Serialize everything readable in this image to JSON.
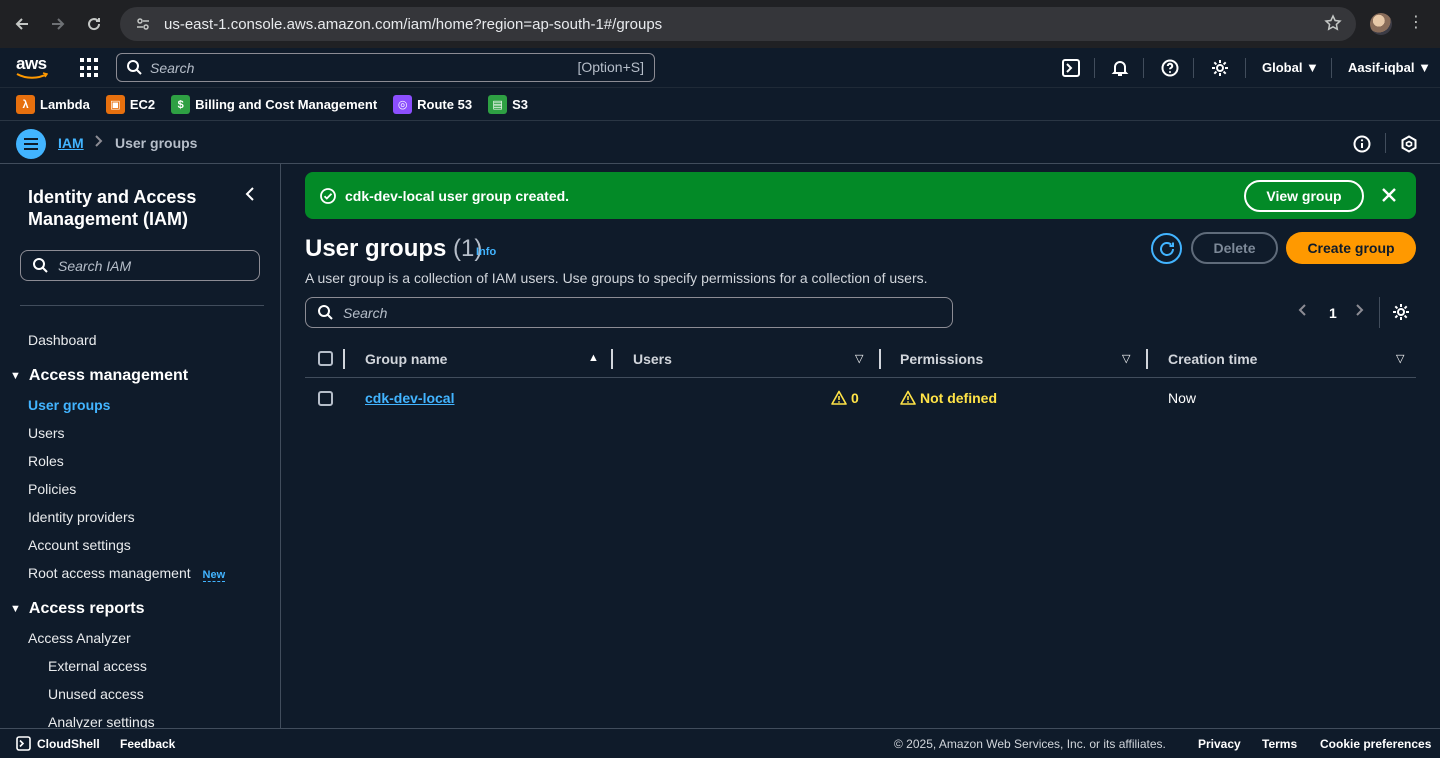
{
  "browser": {
    "url": "us-east-1.console.aws.amazon.com/iam/home?region=ap-south-1#/groups"
  },
  "aws_nav": {
    "logo_text": "aws",
    "search_placeholder": "Search",
    "search_shortcut": "[Option+S]",
    "region": "Global ▼",
    "user": "Aasif-iqbal ▼"
  },
  "favorites": [
    {
      "label": "Lambda",
      "color": "#e7700e",
      "glyph": "λ"
    },
    {
      "label": "EC2",
      "color": "#e7700e",
      "glyph": "▣"
    },
    {
      "label": "Billing and Cost Management",
      "color": "#2ea043",
      "glyph": "$"
    },
    {
      "label": "Route 53",
      "color": "#8c4fff",
      "glyph": "◎"
    },
    {
      "label": "S3",
      "color": "#2ea043",
      "glyph": "▤"
    }
  ],
  "breadcrumb": {
    "root": "IAM",
    "current": "User groups"
  },
  "sidebar": {
    "title": "Identity and Access Management (IAM)",
    "search_placeholder": "Search IAM",
    "dashboard": "Dashboard",
    "access_management": "Access management",
    "items": {
      "user_groups": "User groups",
      "users": "Users",
      "roles": "Roles",
      "policies": "Policies",
      "identity_providers": "Identity providers",
      "account_settings": "Account settings",
      "root_access": "Root access management",
      "new_badge": "New"
    },
    "access_reports": "Access reports",
    "reports": {
      "access_analyzer": "Access Analyzer",
      "external_access": "External access",
      "unused_access": "Unused access",
      "analyzer_settings": "Analyzer settings"
    }
  },
  "flash": {
    "message": "cdk-dev-local user group created.",
    "view_button": "View group"
  },
  "main": {
    "title": "User groups",
    "count": "(1)",
    "info": "Info",
    "description": "A user group is a collection of IAM users. Use groups to specify permissions for a collection of users.",
    "delete_button": "Delete",
    "create_button": "Create group",
    "search_placeholder": "Search",
    "page_number": "1"
  },
  "table": {
    "headers": {
      "group_name": "Group name",
      "users": "Users",
      "permissions": "Permissions",
      "creation_time": "Creation time"
    },
    "rows": [
      {
        "group_name": "cdk-dev-local",
        "users": "0",
        "permissions": "Not defined",
        "creation_time": "Now"
      }
    ]
  },
  "footer": {
    "cloudshell": "CloudShell",
    "feedback": "Feedback",
    "copyright": "© 2025, Amazon Web Services, Inc. or its affiliates.",
    "privacy": "Privacy",
    "terms": "Terms",
    "cookies": "Cookie preferences"
  },
  "colors": {
    "accent": "#42b4ff",
    "primary_button": "#ff9900",
    "success": "#038a27",
    "warning": "#ffe347",
    "background": "#0f1b2a"
  }
}
